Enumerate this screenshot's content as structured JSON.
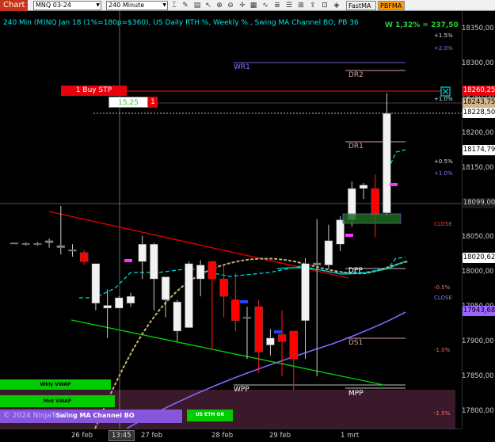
{
  "toolbar": {
    "title": "Chart",
    "instrument": "MNQ 03-24",
    "interval": "240 Minute",
    "btn_fastma": "FastMA",
    "btn_pbfma": "PBFMA"
  },
  "header": {
    "title": "240 Min (M)NQ Jan 18 (1%=180p=$360), US Daily RTH %, Weekly % , Swing MA Channel BO, PB 36",
    "status": "W 1,32% = 237,50"
  },
  "price_axis": {
    "ticks": [
      "18350,00",
      "18300,00",
      "18250,00",
      "18200,00",
      "18150,00",
      "18100,00",
      "18050,00",
      "18000,00",
      "17950,00",
      "17900,00",
      "17850,00",
      "17800,00"
    ],
    "boxes": [
      {
        "label": "18260,25",
        "bg": "#e8000b",
        "fg": "#ffffff"
      },
      {
        "label": "18243,75",
        "bg": "#d2b48c",
        "fg": "#000000"
      },
      {
        "label": "18228,50",
        "bg": "#ffffff",
        "fg": "#000000"
      },
      {
        "label": "18174,79",
        "bg": "#ffffff",
        "fg": "#000000"
      },
      {
        "label": "18099,00",
        "bg": "#1a1a1a",
        "fg": "#cccccc"
      },
      {
        "label": "18020,62",
        "bg": "#ffffff",
        "fg": "#000000"
      },
      {
        "label": "17943,68",
        "bg": "#9966ff",
        "fg": "#000000"
      }
    ]
  },
  "time_axis": {
    "labels": [
      "26 feb",
      "13:45",
      "27 feb",
      "28 feb",
      "29 feb",
      "1 mrt"
    ]
  },
  "annotations": {
    "wr1": "WR1",
    "dr2": "DR2",
    "dr1": "DR1",
    "dpp": "DPP",
    "ds1": "DS1",
    "wpp": "WPP",
    "mpp": "MPP",
    "close1": "CLOSE",
    "close2": "CLOSE",
    "pct_p15": "+1.5%",
    "pct_p20": "+2.0%",
    "pct_p10a": "+1.0%",
    "pct_p05": "+0.5%",
    "pct_p10b": "+1.0%",
    "pct_m05": "-0.5%",
    "pct_m10": "-1.0%",
    "pct_m15": "-1.5%",
    "order_label": "1 Buy STP",
    "order_qty": "15,25",
    "order_count": "1"
  },
  "side_buttons": {
    "wkly_vwap": "Wkly VWAP",
    "mnt_vwap": "Mnt VWAP",
    "swing_ma": "Swing MA Channel BO",
    "us_eth": "US ETH OR",
    "copyright": "© 2024 NinjaTrader"
  },
  "colors": {
    "bull_candle": "#f2f2f2",
    "bear_candle": "#ff0000",
    "neutral_candle": "#888888",
    "red_trend": "#e00000",
    "green_trend": "#00d000",
    "ma_cyan": "#00d5d5",
    "ma_tan": "#c8b070",
    "ma_purple": "#8866ff",
    "purple_zone": "#3a1a2a"
  },
  "chart_data": {
    "type": "candlestick",
    "symbol": "MNQ 03-24",
    "timeframe": "240 Minute",
    "ylim": [
      17775,
      18370
    ],
    "x_labels": [
      "26 feb",
      "13:45",
      "27 feb",
      "28 feb",
      "29 feb",
      "1 mrt"
    ],
    "candles": [
      {
        "o": 18042,
        "h": 18042,
        "l": 18040,
        "c": 18041
      },
      {
        "o": 18040,
        "h": 18043,
        "l": 18038,
        "c": 18041
      },
      {
        "o": 18041,
        "h": 18043,
        "l": 18038,
        "c": 18041
      },
      {
        "o": 18042,
        "h": 18048,
        "l": 18035,
        "c": 18045
      },
      {
        "o": 18035,
        "h": 18095,
        "l": 18025,
        "c": 18038
      },
      {
        "o": 18030,
        "h": 18040,
        "l": 18022,
        "c": 18032
      },
      {
        "o": 18028,
        "h": 18032,
        "l": 18010,
        "c": 18015
      },
      {
        "o": 17955,
        "h": 18012,
        "l": 17945,
        "c": 18012
      },
      {
        "o": 17948,
        "h": 17975,
        "l": 17905,
        "c": 17952
      },
      {
        "o": 17948,
        "h": 17965,
        "l": 17948,
        "c": 17963
      },
      {
        "o": 17955,
        "h": 17970,
        "l": 17950,
        "c": 17965
      },
      {
        "o": 18015,
        "h": 18052,
        "l": 17990,
        "c": 18040
      },
      {
        "o": 17990,
        "h": 18042,
        "l": 17945,
        "c": 18040
      },
      {
        "o": 17960,
        "h": 17990,
        "l": 17935,
        "c": 17993
      },
      {
        "o": 17915,
        "h": 17960,
        "l": 17900,
        "c": 17957
      },
      {
        "o": 17920,
        "h": 18015,
        "l": 17920,
        "c": 18012
      },
      {
        "o": 17990,
        "h": 18017,
        "l": 17965,
        "c": 18010
      },
      {
        "o": 18015,
        "h": 18016,
        "l": 17890,
        "c": 17990
      },
      {
        "o": 17990,
        "h": 18010,
        "l": 17935,
        "c": 17965
      },
      {
        "o": 17960,
        "h": 17998,
        "l": 17915,
        "c": 17930
      },
      {
        "o": 17935,
        "h": 17950,
        "l": 17875,
        "c": 17935
      },
      {
        "o": 17950,
        "h": 17960,
        "l": 17855,
        "c": 17885
      },
      {
        "o": 17895,
        "h": 17918,
        "l": 17880,
        "c": 17905
      },
      {
        "o": 17910,
        "h": 17945,
        "l": 17850,
        "c": 17900
      },
      {
        "o": 17915,
        "h": 17910,
        "l": 17830,
        "c": 17875
      },
      {
        "o": 17930,
        "h": 18020,
        "l": 17875,
        "c": 18012
      },
      {
        "o": 18010,
        "h": 18076,
        "l": 17850,
        "c": 18013
      },
      {
        "o": 18010,
        "h": 18068,
        "l": 18005,
        "c": 18045
      },
      {
        "o": 18040,
        "h": 18080,
        "l": 18030,
        "c": 18075
      },
      {
        "o": 18075,
        "h": 18130,
        "l": 18065,
        "c": 18120
      },
      {
        "o": 18120,
        "h": 18128,
        "l": 18105,
        "c": 18125
      },
      {
        "o": 18120,
        "h": 18140,
        "l": 18050,
        "c": 18082
      },
      {
        "o": 18085,
        "h": 18257,
        "l": 18080,
        "c": 18228
      }
    ],
    "levels": [
      {
        "name": "WR1",
        "price": 18301
      },
      {
        "name": "DR2",
        "price": 18290
      },
      {
        "name": "Buy STP",
        "price": 18260.25
      },
      {
        "name": "DR1",
        "price": 18185
      },
      {
        "name": "DPP",
        "price": 18008
      },
      {
        "name": "DS1",
        "price": 17907
      },
      {
        "name": "WPP",
        "price": 17835
      },
      {
        "name": "MPP",
        "price": 17830
      }
    ]
  }
}
